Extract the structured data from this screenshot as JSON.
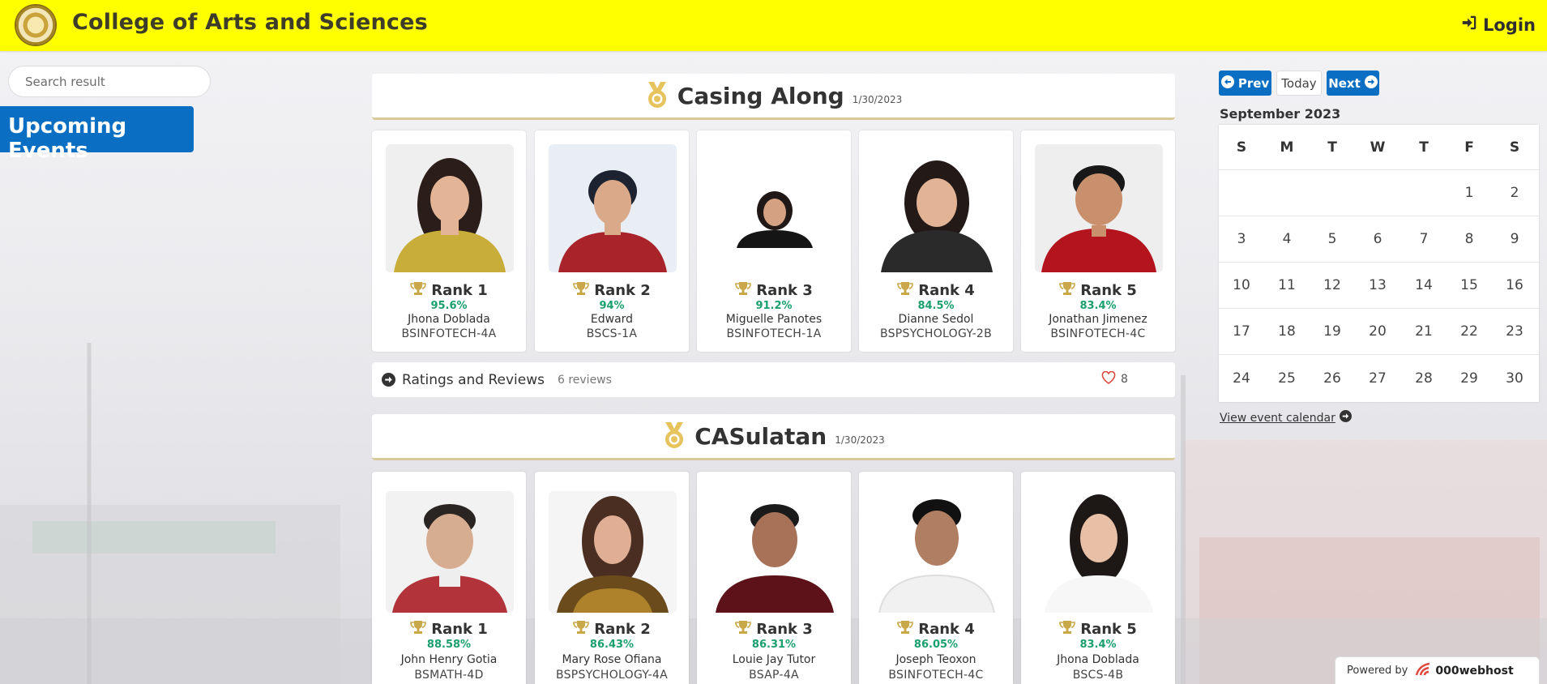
{
  "header": {
    "title": "College of Arts and Sciences",
    "login_label": "Login"
  },
  "sidebar": {
    "search_placeholder": "Search result",
    "upcoming_label": "Upcoming Events"
  },
  "events": [
    {
      "title": "Casing Along",
      "date": "1/30/2023",
      "winners": [
        {
          "rank": "Rank 1",
          "score": "95.6%",
          "name": "Jhona Doblada",
          "course": "BSINFOTECH-4A"
        },
        {
          "rank": "Rank 2",
          "score": "94%",
          "name": "Edward",
          "course": "BSCS-1A"
        },
        {
          "rank": "Rank 3",
          "score": "91.2%",
          "name": "Miguelle Panotes",
          "course": "BSINFOTECH-1A"
        },
        {
          "rank": "Rank 4",
          "score": "84.5%",
          "name": "Dianne Sedol",
          "course": "BSPSYCHOLOGY-2B"
        },
        {
          "rank": "Rank 5",
          "score": "83.4%",
          "name": "Jonathan Jimenez",
          "course": "BSINFOTECH-4C"
        }
      ],
      "reviews": {
        "label": "Ratings and Reviews",
        "count": "6 reviews",
        "likes": "8"
      }
    },
    {
      "title": "CASulatan",
      "date": "1/30/2023",
      "winners": [
        {
          "rank": "Rank 1",
          "score": "88.58%",
          "name": "John Henry Gotia",
          "course": "BSMATH-4D"
        },
        {
          "rank": "Rank 2",
          "score": "86.43%",
          "name": "Mary Rose Ofiana",
          "course": "BSPSYCHOLOGY-4A"
        },
        {
          "rank": "Rank 3",
          "score": "86.31%",
          "name": "Louie Jay Tutor",
          "course": "BSAP-4A"
        },
        {
          "rank": "Rank 4",
          "score": "86.05%",
          "name": "Joseph Teoxon",
          "course": "BSINFOTECH-4C"
        },
        {
          "rank": "Rank 5",
          "score": "83.4%",
          "name": "Jhona Doblada",
          "course": "BSCS-4B"
        }
      ]
    }
  ],
  "calendar": {
    "prev_label": "Prev",
    "today_label": "Today",
    "next_label": "Next",
    "month_label": "September 2023",
    "weekdays": [
      "S",
      "M",
      "T",
      "W",
      "T",
      "F",
      "S"
    ],
    "weeks": [
      [
        "",
        "",
        "",
        "",
        "",
        "1",
        "2"
      ],
      [
        "3",
        "4",
        "5",
        "6",
        "7",
        "8",
        "9"
      ],
      [
        "10",
        "11",
        "12",
        "13",
        "14",
        "15",
        "16"
      ],
      [
        "17",
        "18",
        "19",
        "20",
        "21",
        "22",
        "23"
      ],
      [
        "24",
        "25",
        "26",
        "27",
        "28",
        "29",
        "30"
      ]
    ],
    "view_label": "View event calendar"
  },
  "footer": {
    "powered_label": "Powered by",
    "brand": "000webhost"
  },
  "colors": {
    "header_bg": "#ffff00",
    "primary_blue": "#0a6fc2",
    "score_green": "#1aa06d",
    "heart_red": "#e0483e"
  },
  "icons": {
    "login": "sign-in-icon",
    "medal": "medal-icon",
    "trophy": "trophy-icon",
    "review_arrow": "arrow-circle-right-icon",
    "heart": "heart-icon",
    "prev": "arrow-circle-left-icon",
    "next": "arrow-circle-right-icon"
  }
}
